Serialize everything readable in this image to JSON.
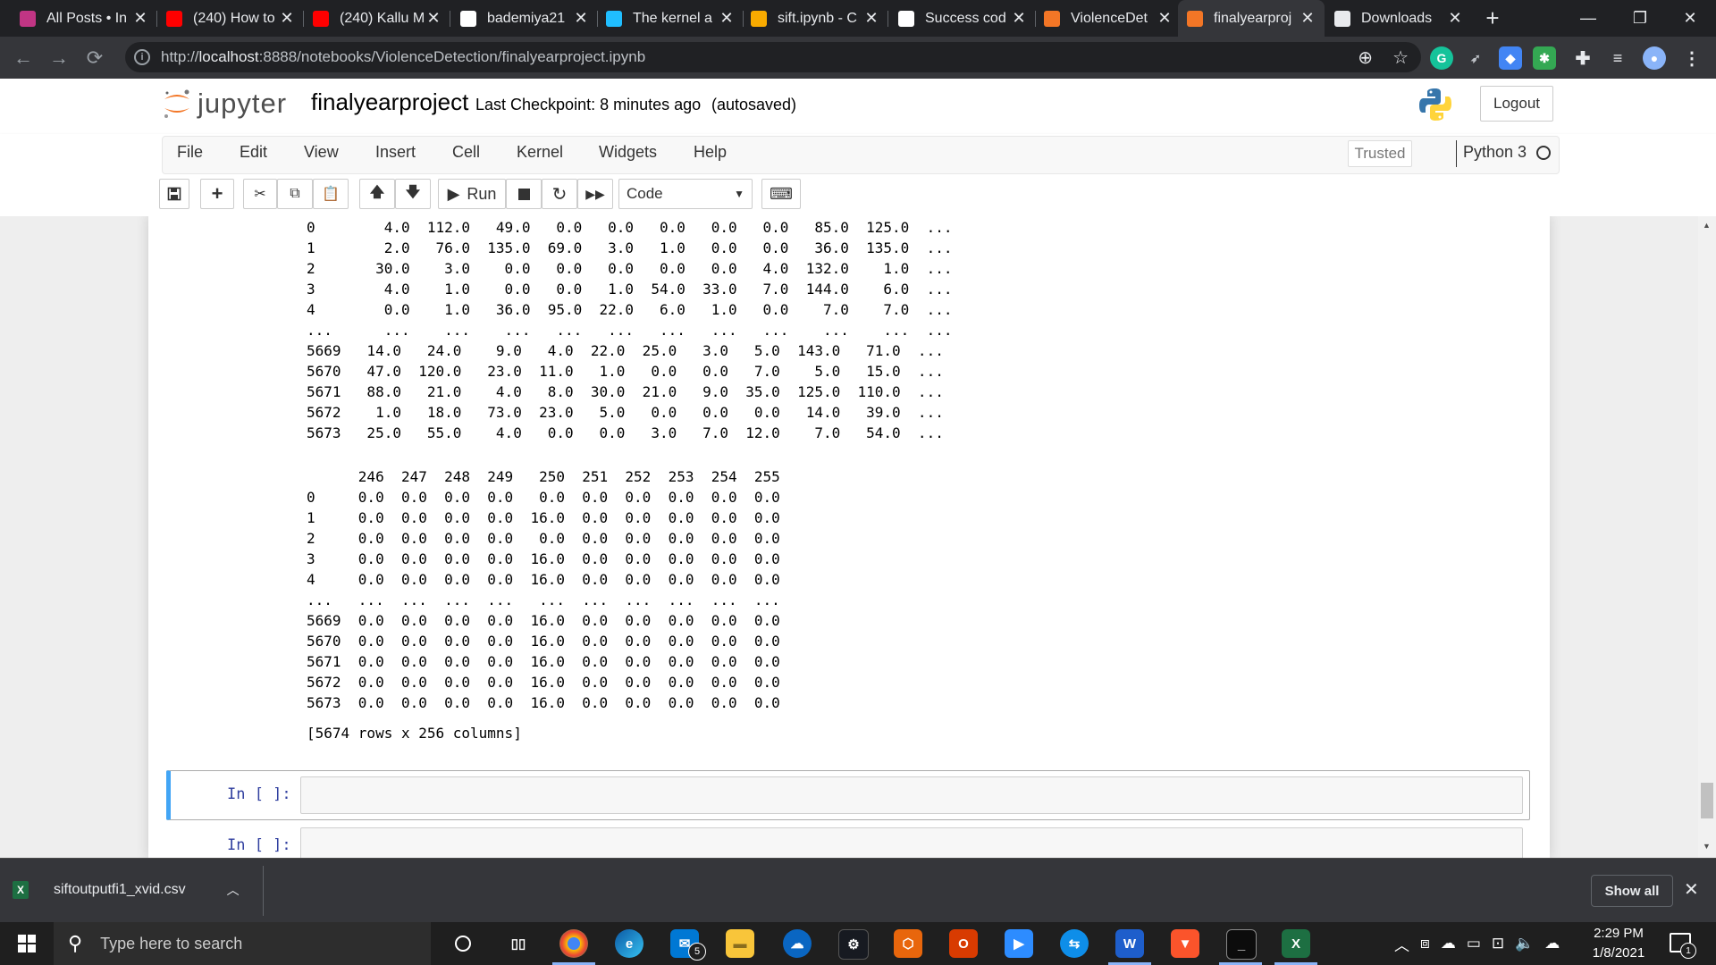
{
  "browser": {
    "tabs": [
      {
        "title": "All Posts • In",
        "icon": "instagram-icon",
        "color": "#c13584"
      },
      {
        "title": "(240) How to",
        "icon": "youtube-icon",
        "color": "#ff0000"
      },
      {
        "title": "(240) Kallu M",
        "icon": "youtube-icon",
        "color": "#ff0000"
      },
      {
        "title": "bademiya21",
        "icon": "github-icon",
        "color": "#ffffff"
      },
      {
        "title": "The kernel a",
        "icon": "kaggle-icon",
        "color": "#20beff"
      },
      {
        "title": "sift.ipynb - C",
        "icon": "colab-icon",
        "color": "#f9ab00"
      },
      {
        "title": "Success cod",
        "icon": "google-icon",
        "color": "#ffffff"
      },
      {
        "title": "ViolenceDet",
        "icon": "jupyter-icon",
        "color": "#f37626"
      },
      {
        "title": "finalyearproj",
        "icon": "notebook-icon",
        "color": "#f37626",
        "active": true
      },
      {
        "title": "Downloads",
        "icon": "download-icon",
        "color": "#e8eaed"
      }
    ],
    "url_prefix": "http://",
    "url_host": "localhost",
    "url_rest": ":8888/notebooks/ViolenceDetection/finalyearproject.ipynb"
  },
  "jupyter": {
    "logo_text": "jupyter",
    "notebook_name": "finalyearproject",
    "checkpoint": "Last Checkpoint: 8 minutes ago",
    "autosave": "(autosaved)",
    "logout": "Logout",
    "menu": [
      "File",
      "Edit",
      "View",
      "Insert",
      "Cell",
      "Kernel",
      "Widgets",
      "Help"
    ],
    "trusted": "Trusted",
    "kernel": "Python 3",
    "run_label": "Run",
    "cell_type": "Code"
  },
  "output": {
    "table1": [
      "0        4.0  112.0   49.0   0.0   0.0   0.0   0.0   0.0   85.0  125.0  ...",
      "1        2.0   76.0  135.0  69.0   3.0   1.0   0.0   0.0   36.0  135.0  ...",
      "2       30.0    3.0    0.0   0.0   0.0   0.0   0.0   4.0  132.0    1.0  ...",
      "3        4.0    1.0    0.0   0.0   1.0  54.0  33.0   7.0  144.0    6.0  ...",
      "4        0.0    1.0   36.0  95.0  22.0   6.0   1.0   0.0    7.0    7.0  ...",
      "...      ...    ...    ...   ...   ...   ...   ...   ...    ...    ...  ...",
      "5669   14.0   24.0    9.0   4.0  22.0  25.0   3.0   5.0  143.0   71.0  ...",
      "5670   47.0  120.0   23.0  11.0   1.0   0.0   0.0   7.0    5.0   15.0  ...",
      "5671   88.0   21.0    4.0   8.0  30.0  21.0   9.0  35.0  125.0  110.0  ...",
      "5672    1.0   18.0   73.0  23.0   5.0   0.0   0.0   0.0   14.0   39.0  ...",
      "5673   25.0   55.0    4.0   0.0   0.0   3.0   7.0  12.0    7.0   54.0  ..."
    ],
    "table2": [
      "      246  247  248  249   250  251  252  253  254  255",
      "0     0.0  0.0  0.0  0.0   0.0  0.0  0.0  0.0  0.0  0.0",
      "1     0.0  0.0  0.0  0.0  16.0  0.0  0.0  0.0  0.0  0.0",
      "2     0.0  0.0  0.0  0.0   0.0  0.0  0.0  0.0  0.0  0.0",
      "3     0.0  0.0  0.0  0.0  16.0  0.0  0.0  0.0  0.0  0.0",
      "4     0.0  0.0  0.0  0.0  16.0  0.0  0.0  0.0  0.0  0.0",
      "...   ...  ...  ...  ...   ...  ...  ...  ...  ...  ...",
      "5669  0.0  0.0  0.0  0.0  16.0  0.0  0.0  0.0  0.0  0.0",
      "5670  0.0  0.0  0.0  0.0  16.0  0.0  0.0  0.0  0.0  0.0",
      "5671  0.0  0.0  0.0  0.0  16.0  0.0  0.0  0.0  0.0  0.0",
      "5672  0.0  0.0  0.0  0.0  16.0  0.0  0.0  0.0  0.0  0.0",
      "5673  0.0  0.0  0.0  0.0  16.0  0.0  0.0  0.0  0.0  0.0"
    ],
    "shape_note": "[5674 rows x 256 columns]",
    "empty_prompt": "In [ ]:"
  },
  "downloads": {
    "file": "siftoutputfi1_xvid.csv",
    "show_all": "Show all"
  },
  "taskbar": {
    "search_placeholder": "Type here to search",
    "time": "2:29 PM",
    "date": "1/8/2021",
    "mail_badge": "5",
    "notif_badge": "1"
  }
}
